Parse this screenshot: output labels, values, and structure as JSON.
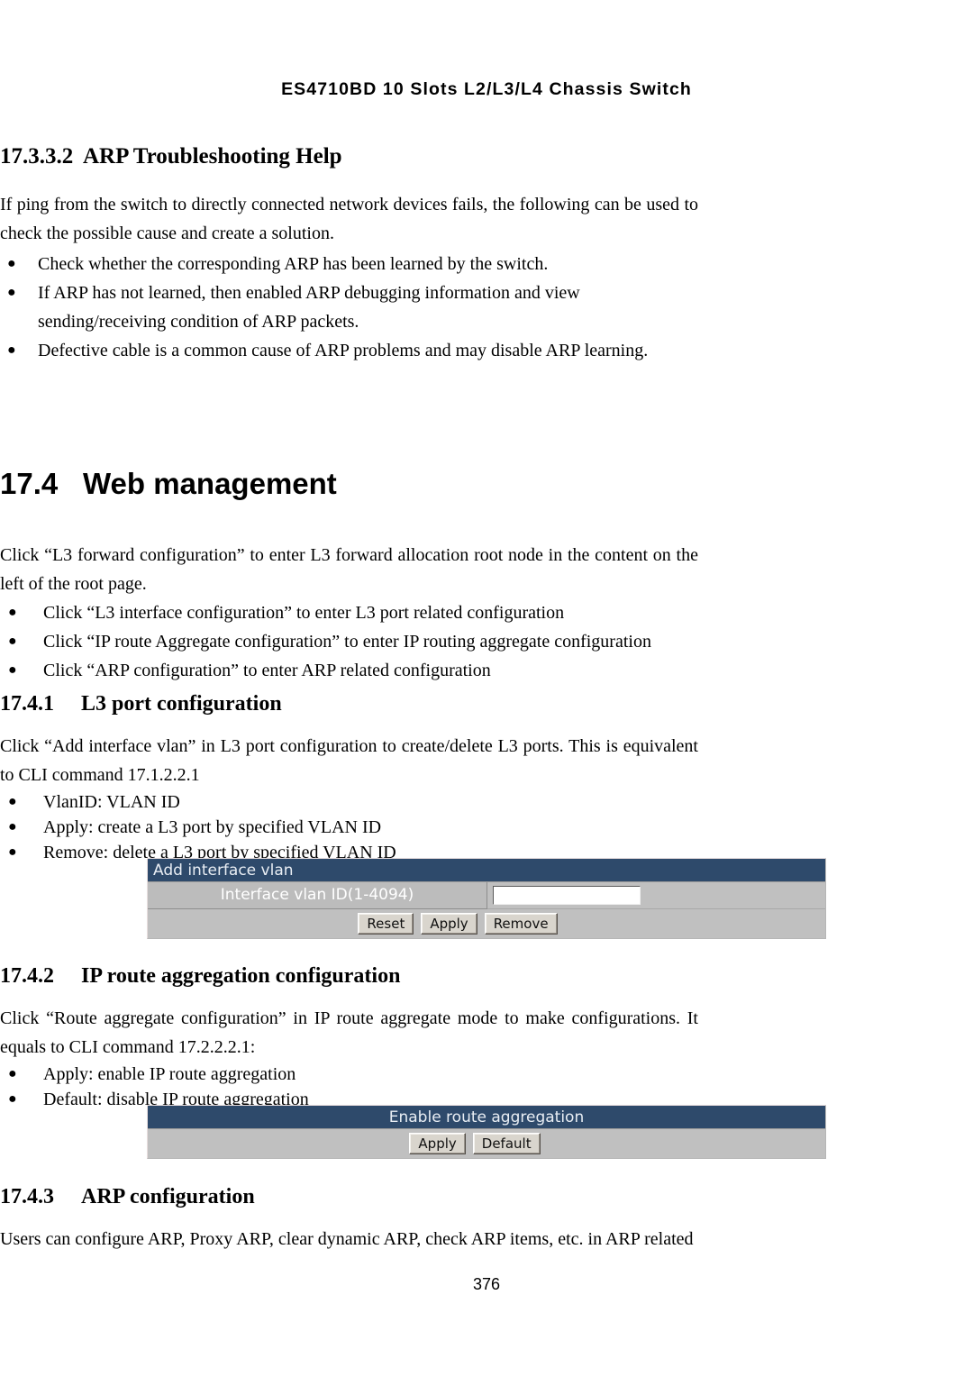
{
  "document": {
    "running_header": "ES4710BD 10 Slots L2/L3/L4 Chassis Switch",
    "page_number": "376"
  },
  "section_17332": {
    "number": "17.3.3.2",
    "title": "ARP Troubleshooting Help",
    "intro": "If ping from the switch to directly connected network devices fails, the following can be used to check the possible cause and create a solution.",
    "bullets": [
      "Check whether the corresponding ARP has been learned by the switch.",
      "If ARP has not learned, then enabled ARP debugging information and view sending/receiving condition of ARP packets.",
      "Defective cable is a common cause of ARP problems and may disable ARP learning."
    ]
  },
  "section_174": {
    "number": "17.4",
    "title": "Web management",
    "intro": "Click “L3 forward configuration” to enter L3 forward allocation root node in the content on the left of the root page.",
    "bullets": [
      "Click “L3 interface configuration” to enter L3 port related configuration",
      "Click “IP route Aggregate configuration” to enter IP routing aggregate configuration",
      "Click “ARP configuration” to enter ARP related configuration"
    ]
  },
  "section_1741": {
    "number": "17.4.1",
    "title": "L3 port configuration",
    "intro": "Click “Add interface vlan” in L3 port configuration to create/delete L3 ports. This is equivalent to CLI command 17.1.2.2.1",
    "bullets": [
      "VlanID: VLAN ID",
      "Apply: create a L3 port by specified VLAN ID",
      "Remove: delete a L3 port by specified VLAN ID"
    ],
    "widget": {
      "title": "Add interface vlan",
      "field_label": "Interface vlan ID(1-4094)",
      "field_value": "",
      "field_placeholder": "",
      "buttons": [
        "Reset",
        "Apply",
        "Remove"
      ],
      "title_bg": "#2e4a6b",
      "body_bg": "#c0c0c0"
    }
  },
  "section_1742": {
    "number": "17.4.2",
    "title": "IP route aggregation configuration",
    "intro": "Click “Route aggregate configuration” in IP route aggregate mode to make configurations. It equals to CLI command 17.2.2.2.1:",
    "bullets": [
      "Apply: enable IP route aggregation",
      "Default: disable IP route aggregation"
    ],
    "widget": {
      "title": "Enable route aggregation",
      "buttons": [
        "Apply",
        "Default"
      ],
      "title_bg": "#2e4a6b",
      "body_bg": "#c0c0c0"
    }
  },
  "section_1743": {
    "number": "17.4.3",
    "title": "ARP configuration",
    "intro": "Users can configure ARP, Proxy ARP, clear dynamic ARP, check ARP items, etc. in ARP related"
  },
  "icons": {
    "bullet": "●"
  }
}
